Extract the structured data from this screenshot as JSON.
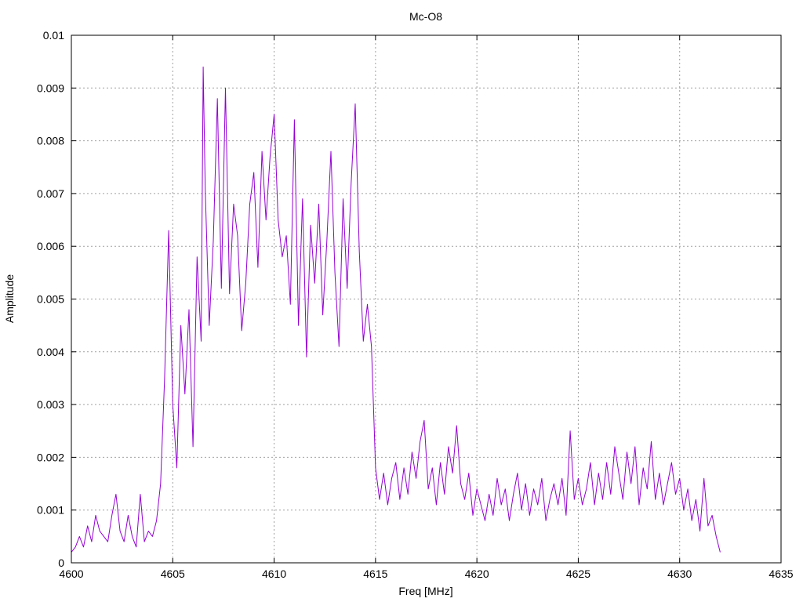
{
  "chart_data": {
    "type": "line",
    "title": "Mc-O8",
    "xlabel": "Freq [MHz]",
    "ylabel": "Amplitude",
    "xlim": [
      4600,
      4635
    ],
    "ylim": [
      0,
      0.01
    ],
    "xticks": [
      "4600",
      "4605",
      "4610",
      "4615",
      "4620",
      "4625",
      "4630",
      "4635"
    ],
    "yticks": [
      "0",
      "0.001",
      "0.002",
      "0.003",
      "0.004",
      "0.005",
      "0.006",
      "0.007",
      "0.008",
      "0.009",
      "0.01"
    ],
    "grid": true,
    "series": [
      {
        "color": "#9400d3",
        "x_range": [
          4600,
          4632
        ],
        "points": [
          [
            4600.0,
            0.0002
          ],
          [
            4600.2,
            0.0003
          ],
          [
            4600.4,
            0.0005
          ],
          [
            4600.6,
            0.0003
          ],
          [
            4600.8,
            0.0007
          ],
          [
            4601.0,
            0.0004
          ],
          [
            4601.2,
            0.0009
          ],
          [
            4601.4,
            0.0006
          ],
          [
            4601.6,
            0.0005
          ],
          [
            4601.8,
            0.0004
          ],
          [
            4602.0,
            0.0009
          ],
          [
            4602.2,
            0.0013
          ],
          [
            4602.4,
            0.0006
          ],
          [
            4602.6,
            0.0004
          ],
          [
            4602.8,
            0.0009
          ],
          [
            4603.0,
            0.0005
          ],
          [
            4603.2,
            0.0003
          ],
          [
            4603.4,
            0.0013
          ],
          [
            4603.6,
            0.0004
          ],
          [
            4603.8,
            0.0006
          ],
          [
            4604.0,
            0.0005
          ],
          [
            4604.2,
            0.0008
          ],
          [
            4604.4,
            0.0015
          ],
          [
            4604.6,
            0.0035
          ],
          [
            4604.8,
            0.0063
          ],
          [
            4605.0,
            0.003
          ],
          [
            4605.2,
            0.0018
          ],
          [
            4605.4,
            0.0045
          ],
          [
            4605.6,
            0.0032
          ],
          [
            4605.8,
            0.0048
          ],
          [
            4606.0,
            0.0022
          ],
          [
            4606.2,
            0.0058
          ],
          [
            4606.4,
            0.0042
          ],
          [
            4606.5,
            0.0094
          ],
          [
            4606.6,
            0.0071
          ],
          [
            4606.8,
            0.0045
          ],
          [
            4607.0,
            0.0061
          ],
          [
            4607.2,
            0.0088
          ],
          [
            4607.4,
            0.0052
          ],
          [
            4607.6,
            0.009
          ],
          [
            4607.8,
            0.0051
          ],
          [
            4608.0,
            0.0068
          ],
          [
            4608.2,
            0.0062
          ],
          [
            4608.4,
            0.0044
          ],
          [
            4608.6,
            0.0053
          ],
          [
            4608.8,
            0.0068
          ],
          [
            4609.0,
            0.0074
          ],
          [
            4609.2,
            0.0056
          ],
          [
            4609.4,
            0.0078
          ],
          [
            4609.6,
            0.0065
          ],
          [
            4609.8,
            0.0077
          ],
          [
            4610.0,
            0.0085
          ],
          [
            4610.2,
            0.0065
          ],
          [
            4610.4,
            0.0058
          ],
          [
            4610.6,
            0.0062
          ],
          [
            4610.8,
            0.0049
          ],
          [
            4611.0,
            0.0084
          ],
          [
            4611.2,
            0.0045
          ],
          [
            4611.4,
            0.0069
          ],
          [
            4611.6,
            0.0039
          ],
          [
            4611.8,
            0.0064
          ],
          [
            4612.0,
            0.0053
          ],
          [
            4612.2,
            0.0068
          ],
          [
            4612.4,
            0.0047
          ],
          [
            4612.6,
            0.0061
          ],
          [
            4612.8,
            0.0078
          ],
          [
            4613.0,
            0.0055
          ],
          [
            4613.2,
            0.0041
          ],
          [
            4613.4,
            0.0069
          ],
          [
            4613.6,
            0.0052
          ],
          [
            4613.8,
            0.0072
          ],
          [
            4614.0,
            0.0087
          ],
          [
            4614.2,
            0.0059
          ],
          [
            4614.4,
            0.0042
          ],
          [
            4614.6,
            0.0049
          ],
          [
            4614.8,
            0.0041
          ],
          [
            4615.0,
            0.0018
          ],
          [
            4615.2,
            0.0012
          ],
          [
            4615.4,
            0.0017
          ],
          [
            4615.6,
            0.0011
          ],
          [
            4615.8,
            0.0016
          ],
          [
            4616.0,
            0.0019
          ],
          [
            4616.2,
            0.0012
          ],
          [
            4616.4,
            0.0018
          ],
          [
            4616.6,
            0.0013
          ],
          [
            4616.8,
            0.0021
          ],
          [
            4617.0,
            0.0016
          ],
          [
            4617.2,
            0.0023
          ],
          [
            4617.4,
            0.0027
          ],
          [
            4617.6,
            0.0014
          ],
          [
            4617.8,
            0.0018
          ],
          [
            4618.0,
            0.0011
          ],
          [
            4618.2,
            0.0019
          ],
          [
            4618.4,
            0.0013
          ],
          [
            4618.6,
            0.0022
          ],
          [
            4618.8,
            0.0017
          ],
          [
            4619.0,
            0.0026
          ],
          [
            4619.2,
            0.0015
          ],
          [
            4619.4,
            0.0012
          ],
          [
            4619.6,
            0.0017
          ],
          [
            4619.8,
            0.0009
          ],
          [
            4620.0,
            0.0014
          ],
          [
            4620.2,
            0.0011
          ],
          [
            4620.4,
            0.0008
          ],
          [
            4620.6,
            0.0013
          ],
          [
            4620.8,
            0.0009
          ],
          [
            4621.0,
            0.0016
          ],
          [
            4621.2,
            0.0011
          ],
          [
            4621.4,
            0.0014
          ],
          [
            4621.6,
            0.0008
          ],
          [
            4621.8,
            0.0013
          ],
          [
            4622.0,
            0.0017
          ],
          [
            4622.2,
            0.001
          ],
          [
            4622.4,
            0.0015
          ],
          [
            4622.6,
            0.0009
          ],
          [
            4622.8,
            0.0014
          ],
          [
            4623.0,
            0.0011
          ],
          [
            4623.2,
            0.0016
          ],
          [
            4623.4,
            0.0008
          ],
          [
            4623.6,
            0.0012
          ],
          [
            4623.8,
            0.0015
          ],
          [
            4624.0,
            0.0011
          ],
          [
            4624.2,
            0.0016
          ],
          [
            4624.4,
            0.0009
          ],
          [
            4624.6,
            0.0025
          ],
          [
            4624.8,
            0.0012
          ],
          [
            4625.0,
            0.0016
          ],
          [
            4625.2,
            0.0011
          ],
          [
            4625.4,
            0.0014
          ],
          [
            4625.6,
            0.0019
          ],
          [
            4625.8,
            0.0011
          ],
          [
            4626.0,
            0.0017
          ],
          [
            4626.2,
            0.0012
          ],
          [
            4626.4,
            0.0019
          ],
          [
            4626.6,
            0.0013
          ],
          [
            4626.8,
            0.0022
          ],
          [
            4627.0,
            0.0017
          ],
          [
            4627.2,
            0.0012
          ],
          [
            4627.4,
            0.0021
          ],
          [
            4627.6,
            0.0015
          ],
          [
            4627.8,
            0.0022
          ],
          [
            4628.0,
            0.0011
          ],
          [
            4628.2,
            0.0018
          ],
          [
            4628.4,
            0.0014
          ],
          [
            4628.6,
            0.0023
          ],
          [
            4628.8,
            0.0012
          ],
          [
            4629.0,
            0.0017
          ],
          [
            4629.2,
            0.0011
          ],
          [
            4629.4,
            0.0015
          ],
          [
            4629.6,
            0.0019
          ],
          [
            4629.8,
            0.0013
          ],
          [
            4630.0,
            0.0016
          ],
          [
            4630.2,
            0.001
          ],
          [
            4630.4,
            0.0014
          ],
          [
            4630.6,
            0.0008
          ],
          [
            4630.8,
            0.0012
          ],
          [
            4631.0,
            0.0006
          ],
          [
            4631.2,
            0.0016
          ],
          [
            4631.4,
            0.0007
          ],
          [
            4631.6,
            0.0009
          ],
          [
            4631.8,
            0.0005
          ],
          [
            4632.0,
            0.0002
          ]
        ]
      }
    ]
  }
}
